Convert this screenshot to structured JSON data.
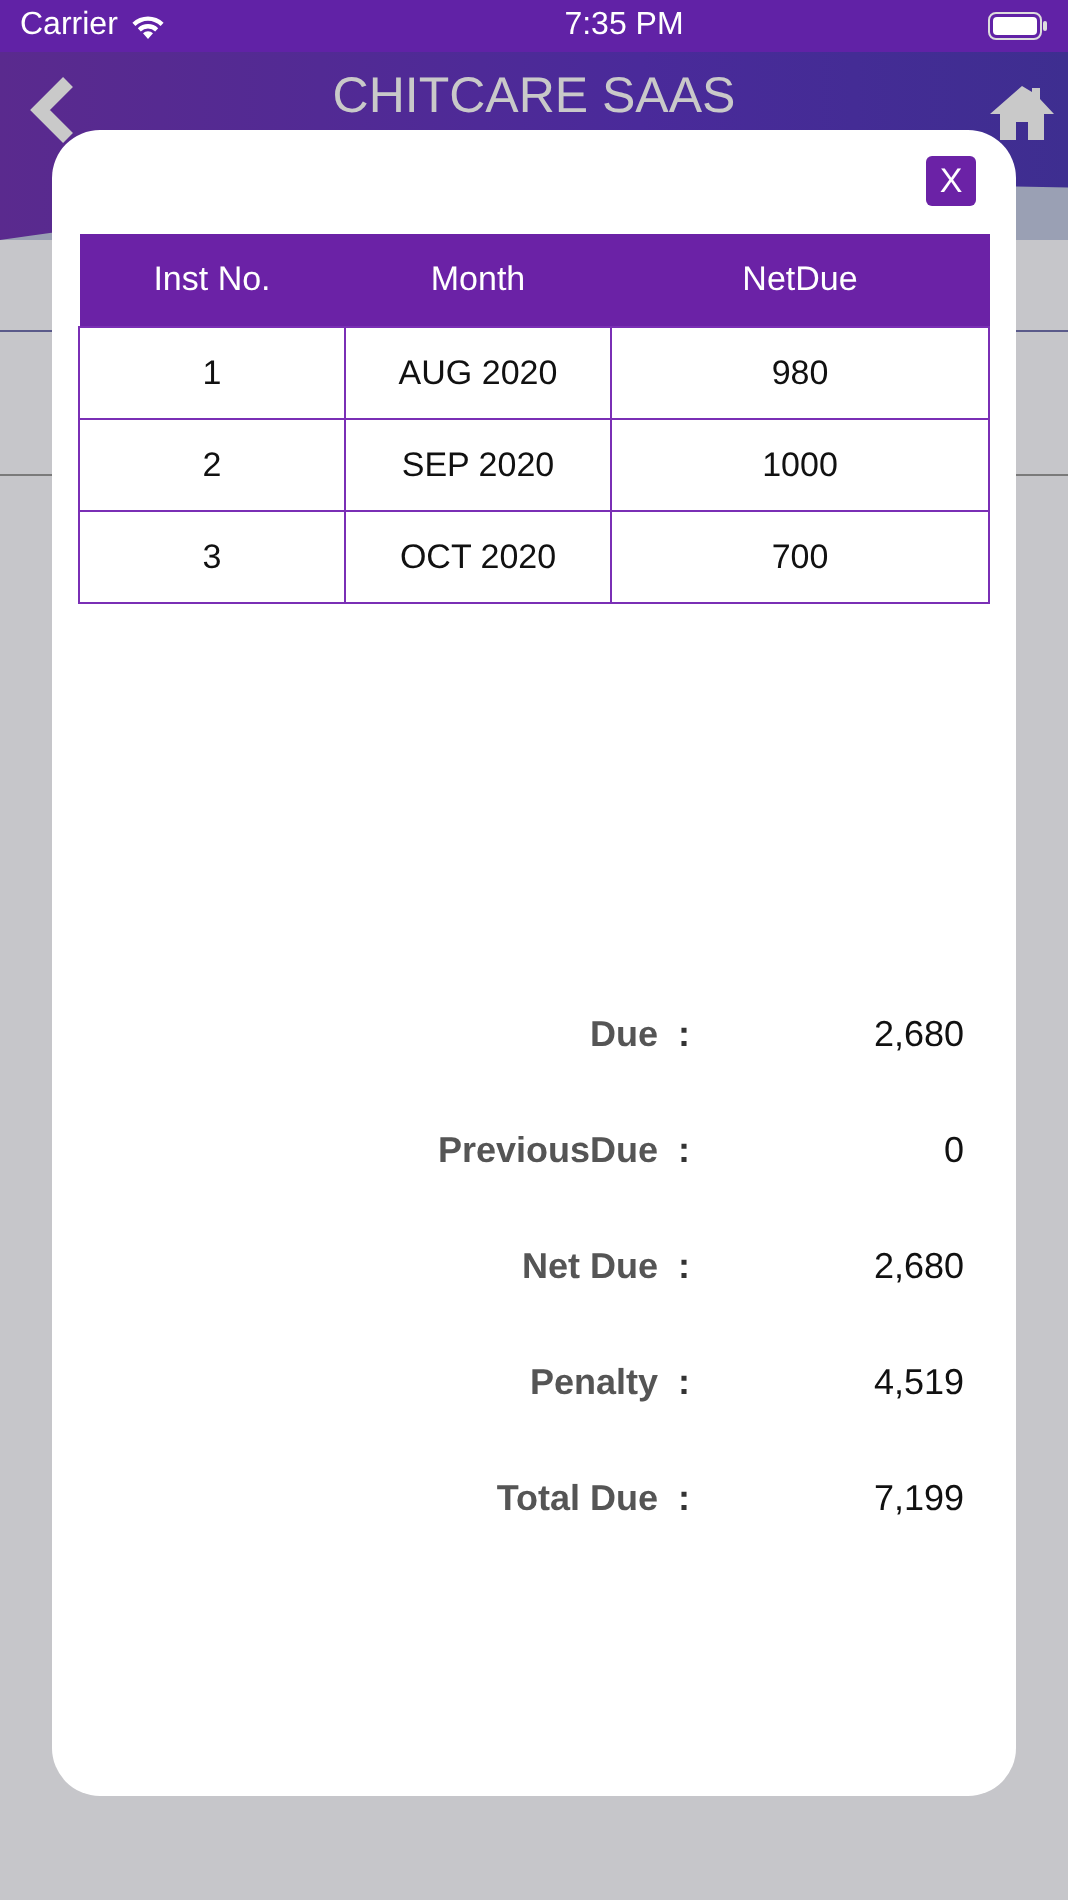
{
  "status_bar": {
    "carrier": "Carrier",
    "time": "7:35 PM"
  },
  "header": {
    "title": "CHITCARE SAAS"
  },
  "modal": {
    "close": "X",
    "table": {
      "columns": [
        "Inst No.",
        "Month",
        "NetDue"
      ],
      "rows": [
        [
          "1",
          "AUG 2020",
          "980"
        ],
        [
          "2",
          "SEP 2020",
          "1000"
        ],
        [
          "3",
          "OCT 2020",
          "700"
        ]
      ]
    },
    "summary": [
      {
        "label": "Due",
        "separator": ":",
        "value": "2,680"
      },
      {
        "label": "PreviousDue",
        "separator": ":",
        "value": "0"
      },
      {
        "label": "Net Due",
        "separator": ":",
        "value": "2,680"
      },
      {
        "label": "Penalty",
        "separator": ":",
        "value": "4,519"
      },
      {
        "label": "Total Due",
        "separator": ":",
        "value": "7,199"
      }
    ]
  }
}
